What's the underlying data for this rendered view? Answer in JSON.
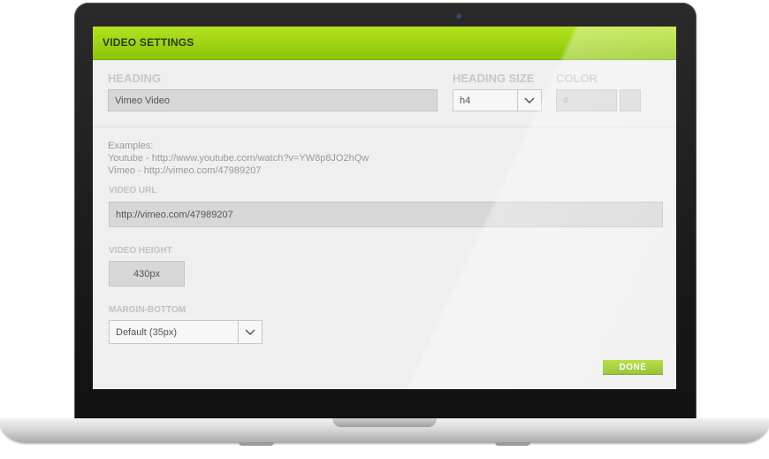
{
  "header": {
    "title": "VIDEO SETTINGS"
  },
  "heading": {
    "label": "HEADING",
    "value": "Vimeo Video"
  },
  "heading_size": {
    "label": "HEADING SIZE",
    "value": "h4"
  },
  "color": {
    "label": "COLOR",
    "placeholder": "#"
  },
  "examples": {
    "title": "Examples:",
    "youtube": "Youtube - http://www.youtube.com/watch?v=YW8p8JO2hQw",
    "vimeo": "Vimeo - http://vimeo.com/47989207"
  },
  "video_url": {
    "label": "VIDEO URL",
    "value": "http://vimeo.com/47989207"
  },
  "video_height": {
    "label": "VIDEO HEIGHT",
    "value": "430px"
  },
  "margin_bottom": {
    "label": "MARGIN-BOTTOM",
    "value": "Default (35px)"
  },
  "done_label": "DONE",
  "colors": {
    "accent": "#9acd0f",
    "header_text": "#2d3b05"
  }
}
